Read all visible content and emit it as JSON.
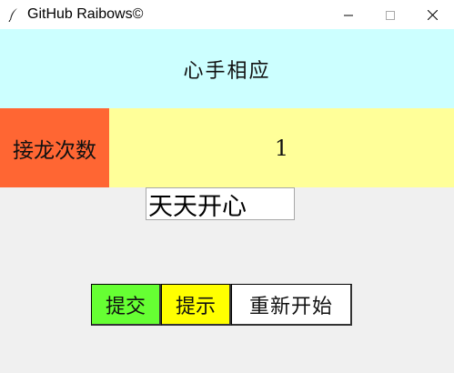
{
  "window": {
    "title": "GitHub Raibows©",
    "icon": "feather-icon",
    "controls": [
      "minimize-icon",
      "maximize-icon",
      "close-icon"
    ]
  },
  "header": {
    "text": "心手相应",
    "color": "#ccffff"
  },
  "counter": {
    "label": "接龙次数",
    "value": "1",
    "label_color": "#ff6633",
    "value_color": "#ffff99"
  },
  "input": {
    "value": "天天开心"
  },
  "buttons": {
    "submit": {
      "label": "提交",
      "color": "#66ff33"
    },
    "hint": {
      "label": "提示",
      "color": "#ffff00"
    },
    "restart": {
      "label": "重新开始",
      "color": "#ffffff"
    }
  }
}
